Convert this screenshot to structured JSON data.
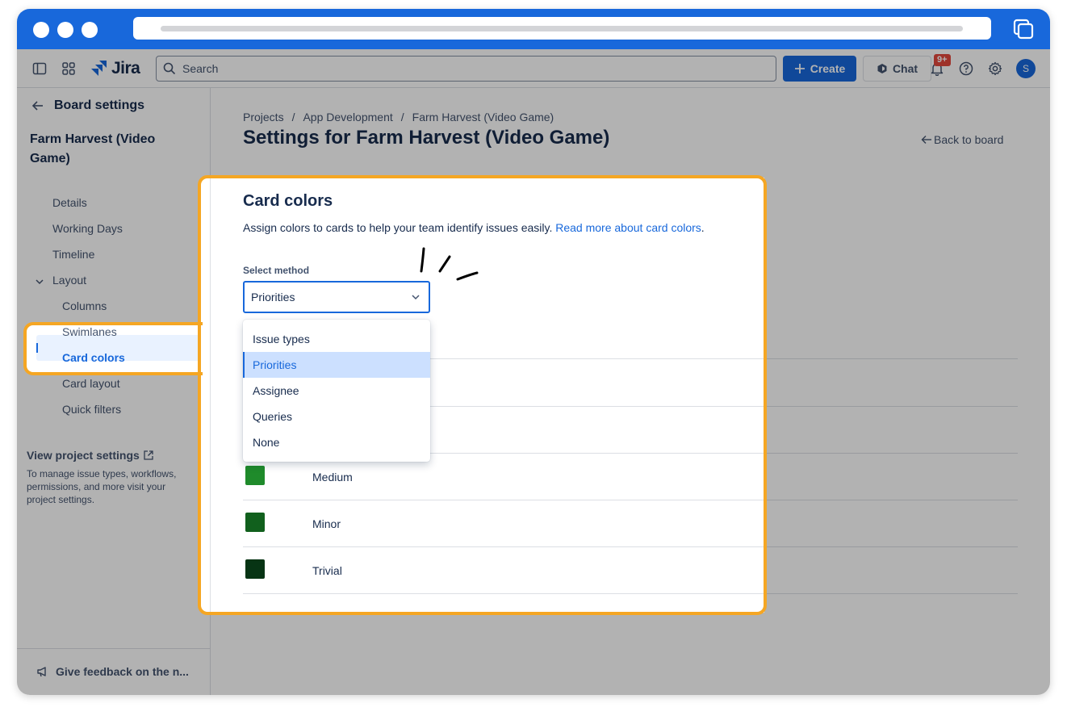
{
  "app": {
    "logo_text": "Jira",
    "search_placeholder": "Search",
    "create_label": "Create",
    "chat_label": "Chat",
    "notifications_badge": "9+",
    "avatar_initial": "S"
  },
  "sidebar": {
    "back_label": "Board settings",
    "project_name": "Farm Harvest (Video Game)",
    "items": [
      {
        "label": "Details"
      },
      {
        "label": "Working Days"
      },
      {
        "label": "Timeline"
      },
      {
        "label": "Layout"
      },
      {
        "label": "Columns"
      },
      {
        "label": "Swimlanes"
      },
      {
        "label": "Card colors"
      },
      {
        "label": "Card layout"
      },
      {
        "label": "Quick filters"
      }
    ],
    "view_project_settings": "View project settings",
    "description": "To manage issue types, workflows, permissions, and more visit your project settings.",
    "feedback": "Give feedback on the n..."
  },
  "main": {
    "breadcrumb": [
      "Projects",
      "/",
      "App Development",
      "/",
      "Farm Harvest (Video Game)"
    ],
    "title": "Settings for Farm Harvest (Video Game)",
    "back_to_board": "Back to board",
    "section_title": "Card colors",
    "section_desc": "Assign colors to cards to help your team identify issues easily.",
    "read_more": "Read more about card colors",
    "desc_period": ".",
    "select_label": "Select method",
    "select_value": "Priorities",
    "dropdown_options": [
      "Issue types",
      "Priorities",
      "Assignee",
      "Queries",
      "None"
    ],
    "rows": [
      {
        "label": "Medium",
        "color": "#1f8b2b"
      },
      {
        "label": "Minor",
        "color": "#11601d"
      },
      {
        "label": "Trivial",
        "color": "#073414"
      }
    ]
  },
  "colors": {
    "brand": "#1868db",
    "highlight": "#f5a623"
  }
}
